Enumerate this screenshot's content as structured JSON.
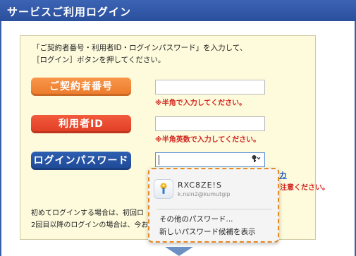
{
  "header": {
    "title": "サービスご利用ログイン"
  },
  "intro": {
    "line1": "「ご契約者番号・利用者ID・ログインパスワード」を入力して、",
    "line2": "［ログイン］ボタンを押してください。"
  },
  "fields": {
    "contract_label": "ご契約者番号",
    "contract_hint": "※半角で入力してください。",
    "userid_label": "利用者ID",
    "userid_hint": "※半角英数で入力してください。",
    "password_label": "ログインパスワード"
  },
  "side": {
    "link_fragment": "カ",
    "note_fragment": "注意ください。"
  },
  "bottom": {
    "line1": "初めてログインする場合は、初回ロ",
    "line2": "2回目以降のログインの場合は、今お"
  },
  "autofill_popup": {
    "credential_name": "RXC8ZE!S",
    "credential_user": "k.nsin2@kumutgip",
    "other_passwords": "その他のパスワード...",
    "suggest_new": "新しいパスワード候補を表示"
  },
  "colors": {
    "header": "#2a4f9c",
    "contract_btn": "#ec7a2a",
    "userid_btn": "#df3d22",
    "password_btn": "#1e4894",
    "hint": "#d2231c",
    "popup_border": "#e58a24"
  },
  "icons": {
    "password_key": "key-icon",
    "chevron": "chevron-down-icon",
    "credential": "passwords-app-icon",
    "scroll": "down-arrow-icon"
  }
}
